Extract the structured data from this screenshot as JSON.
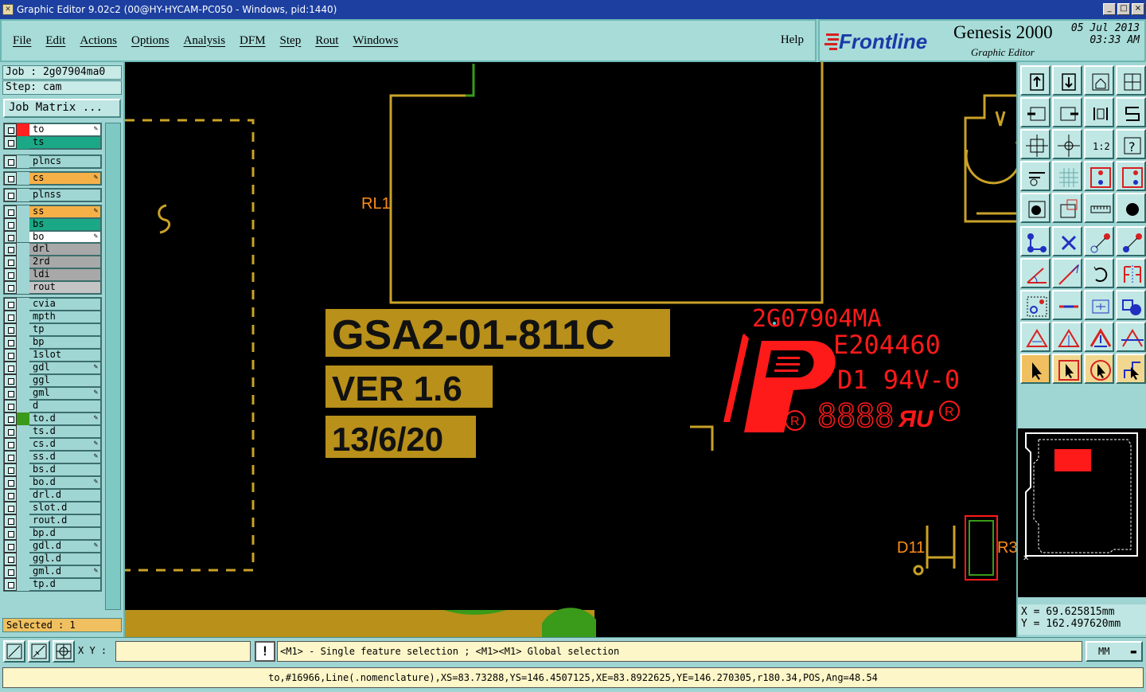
{
  "window": {
    "title": "Graphic Editor 9.02c2 (00@HY-HYCAM-PC050 - Windows, pid:1440)",
    "app_icon": "app-icon",
    "buttons": [
      "_",
      "□",
      "×"
    ]
  },
  "menu": {
    "items": [
      "File",
      "Edit",
      "Actions",
      "Options",
      "Analysis",
      "DFM",
      "Step",
      "Rout",
      "Windows"
    ],
    "help": "Help"
  },
  "brand": {
    "logo": "Frontline",
    "product": "Genesis 2000",
    "subtitle": "Graphic Editor",
    "date": "05 Jul 2013",
    "time": "03:33 AM"
  },
  "job": {
    "job_label": "Job : 2g07904ma0",
    "step_label": "Step: cam",
    "job_matrix": "Job Matrix ..."
  },
  "layers": [
    {
      "name": "to",
      "color": "#ffffff",
      "swatch": "#ff2020",
      "mark": "edit",
      "group": 0
    },
    {
      "name": "ts",
      "color": "#1aa886",
      "swatch": "#1aa886",
      "mark": "",
      "group": 0
    },
    {
      "name": "plncs",
      "color": "#9fd5d3",
      "swatch": "#9fd5d3",
      "mark": "",
      "group": 1
    },
    {
      "name": "cs",
      "color": "#f5b048",
      "swatch": "#9fd5d3",
      "mark": "edit",
      "group": 2
    },
    {
      "name": "plnss",
      "color": "#9fd5d3",
      "swatch": "#9fd5d3",
      "mark": "",
      "group": 3
    },
    {
      "name": "ss",
      "color": "#f5b048",
      "swatch": "#9fd5d3",
      "mark": "edit",
      "group": 4
    },
    {
      "name": "bs",
      "color": "#1aa886",
      "swatch": "#9fd5d3",
      "mark": "",
      "group": 4
    },
    {
      "name": "bo",
      "color": "#ffffff",
      "swatch": "#9fd5d3",
      "mark": "edit",
      "group": 4
    },
    {
      "name": "drl",
      "color": "#a8a8a8",
      "swatch": "#9fd5d3",
      "mark": "",
      "group": 5
    },
    {
      "name": "2rd",
      "color": "#a8a8a8",
      "swatch": "#9fd5d3",
      "mark": "",
      "group": 5
    },
    {
      "name": "ldi",
      "color": "#a8a8a8",
      "swatch": "#9fd5d3",
      "mark": "",
      "group": 5
    },
    {
      "name": "rout",
      "color": "#c4c4c4",
      "swatch": "#9fd5d3",
      "mark": "",
      "group": 5
    },
    {
      "name": "cvia",
      "color": "#9fd5d3",
      "swatch": "#9fd5d3",
      "mark": "",
      "group": 6
    },
    {
      "name": "mpth",
      "color": "#9fd5d3",
      "swatch": "#9fd5d3",
      "mark": "",
      "group": 6
    },
    {
      "name": "tp",
      "color": "#9fd5d3",
      "swatch": "#9fd5d3",
      "mark": "",
      "group": 6
    },
    {
      "name": "bp",
      "color": "#9fd5d3",
      "swatch": "#9fd5d3",
      "mark": "",
      "group": 6
    },
    {
      "name": "1slot",
      "color": "#9fd5d3",
      "swatch": "#9fd5d3",
      "mark": "",
      "group": 6
    },
    {
      "name": "gdl",
      "color": "#9fd5d3",
      "swatch": "#9fd5d3",
      "mark": "edit",
      "group": 6
    },
    {
      "name": "ggl",
      "color": "#9fd5d3",
      "swatch": "#9fd5d3",
      "mark": "",
      "group": 6
    },
    {
      "name": "gml",
      "color": "#9fd5d3",
      "swatch": "#9fd5d3",
      "mark": "edit",
      "group": 6
    },
    {
      "name": "d",
      "color": "#9fd5d3",
      "swatch": "#9fd5d3",
      "mark": "",
      "group": 6
    },
    {
      "name": "to.d",
      "color": "#9fd5d3",
      "swatch": "#3a9a1a",
      "mark": "edit",
      "group": 6
    },
    {
      "name": "ts.d",
      "color": "#9fd5d3",
      "swatch": "#9fd5d3",
      "mark": "",
      "group": 6
    },
    {
      "name": "cs.d",
      "color": "#9fd5d3",
      "swatch": "#9fd5d3",
      "mark": "edit",
      "group": 6
    },
    {
      "name": "ss.d",
      "color": "#9fd5d3",
      "swatch": "#9fd5d3",
      "mark": "edit",
      "group": 6
    },
    {
      "name": "bs.d",
      "color": "#9fd5d3",
      "swatch": "#9fd5d3",
      "mark": "",
      "group": 6
    },
    {
      "name": "bo.d",
      "color": "#9fd5d3",
      "swatch": "#9fd5d3",
      "mark": "edit",
      "group": 6
    },
    {
      "name": "drl.d",
      "color": "#9fd5d3",
      "swatch": "#9fd5d3",
      "mark": "",
      "group": 6
    },
    {
      "name": "slot.d",
      "color": "#9fd5d3",
      "swatch": "#9fd5d3",
      "mark": "",
      "group": 6
    },
    {
      "name": "rout.d",
      "color": "#9fd5d3",
      "swatch": "#9fd5d3",
      "mark": "",
      "group": 6
    },
    {
      "name": "bp.d",
      "color": "#9fd5d3",
      "swatch": "#9fd5d3",
      "mark": "",
      "group": 6
    },
    {
      "name": "gdl.d",
      "color": "#9fd5d3",
      "swatch": "#9fd5d3",
      "mark": "edit",
      "group": 6
    },
    {
      "name": "ggl.d",
      "color": "#9fd5d3",
      "swatch": "#9fd5d3",
      "mark": "",
      "group": 6
    },
    {
      "name": "gml.d",
      "color": "#9fd5d3",
      "swatch": "#9fd5d3",
      "mark": "edit",
      "group": 6
    },
    {
      "name": "tp.d",
      "color": "#9fd5d3",
      "swatch": "#9fd5d3",
      "mark": "",
      "group": 6
    }
  ],
  "selected": "Selected : 1",
  "board": {
    "part_label": "RL1",
    "text_block": [
      "GSA2-01-811C",
      "VER 1.6",
      "13/6/20"
    ],
    "red_marking": [
      "2G07904MA",
      "E204460",
      "D1 94V-0",
      "8888"
    ],
    "ref_d11": "D11",
    "ref_r3": "R3",
    "colors": {
      "outline": "#c9a227",
      "text_bg": "#b8901a",
      "marking": "#ff1a1a",
      "copper": "#3a9a1a",
      "label": "#ff8c1a"
    }
  },
  "tools": {
    "icons": [
      "move-up-icon",
      "move-down-icon",
      "home-icon",
      "window-icon",
      "pan-left-icon",
      "pan-right-icon",
      "flip-icon",
      "s-shape-icon",
      "zoom-fit-icon",
      "zoom-center-icon",
      "scale-1-2-icon",
      "help-icon",
      "measure-tool-icon",
      "grid-icon",
      "layer-compare-icon",
      "layer-compare-2-icon",
      "select-pad-icon",
      "edit-shape-icon",
      "ruler-icon",
      "stop-icon",
      "connect-icon",
      "cross-icon",
      "point-line-icon",
      "point-line-2-icon",
      "angle-icon",
      "arrow-line-icon",
      "rotate-icon",
      "mirror-icon",
      "snap-icon",
      "line-icon",
      "center-icon",
      "group-icon",
      "triangle-icon",
      "triangle-up-icon",
      "triangle-arrow-icon",
      "triangle-measure-icon",
      "pointer-icon",
      "pointer-box-icon",
      "pointer-circle-icon",
      "pointer-route-icon"
    ]
  },
  "coords": {
    "x_label": "X  =  69.625815mm",
    "y_label": "Y  =  162.497620mm"
  },
  "bottom": {
    "xy_label": "X Y :",
    "xy_value": "",
    "warn": "!",
    "hint": "<M1> - Single feature selection ; <M1><M1> Global selection",
    "units": "MM"
  },
  "status": "to,#16966,Line(.nomenclature),XS=83.73288,YS=146.4507125,XE=83.8922625,YE=146.270305,r180.34,POS,Ang=48.54"
}
